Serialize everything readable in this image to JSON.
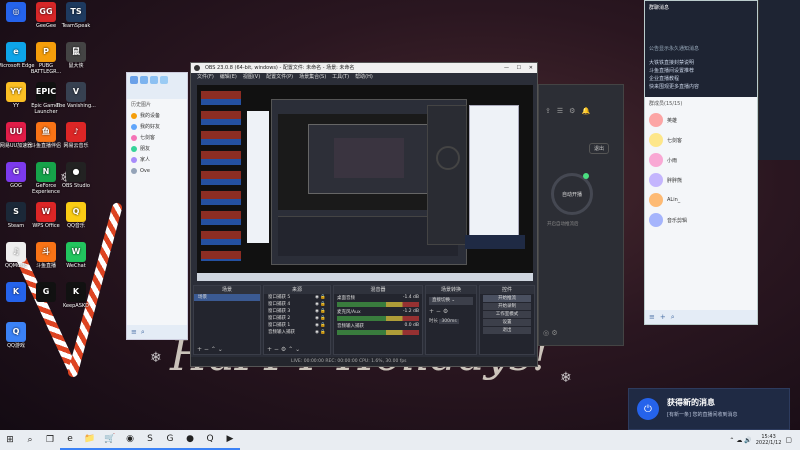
{
  "desktop_icons": [
    {
      "label": "",
      "color": "#2563eb",
      "glyph": "◎"
    },
    {
      "label": "GeeGee",
      "color": "#d62728",
      "glyph": "GG"
    },
    {
      "label": "TeamSpeak",
      "color": "#1e3a5f",
      "glyph": "TS"
    },
    {
      "label": "Microsoft Edge",
      "color": "#0ea5e9",
      "glyph": "e"
    },
    {
      "label": "PUBG BATTLEGR...",
      "color": "#f59e0b",
      "glyph": "P"
    },
    {
      "label": "鼠大侠",
      "color": "#444",
      "glyph": "鼠"
    },
    {
      "label": "YY",
      "color": "#fbbf24",
      "glyph": "YY"
    },
    {
      "label": "Epic Games Launcher",
      "color": "#111",
      "glyph": "EPIC"
    },
    {
      "label": "The Vanishing...",
      "color": "#374151",
      "glyph": "V"
    },
    {
      "label": "网易UU加速器",
      "color": "#e11d48",
      "glyph": "UU"
    },
    {
      "label": "斗鱼直播伴侣",
      "color": "#f97316",
      "glyph": "鱼"
    },
    {
      "label": "网易云音乐",
      "color": "#dc2626",
      "glyph": "♪"
    },
    {
      "label": "GOG",
      "color": "#7c3aed",
      "glyph": "G"
    },
    {
      "label": "GeForce Experience",
      "color": "#16a34a",
      "glyph": "N"
    },
    {
      "label": "OBS Studio",
      "color": "#222",
      "glyph": "●"
    },
    {
      "label": "Steam",
      "color": "#1b2838",
      "glyph": "S"
    },
    {
      "label": "WPS Office",
      "color": "#dc2626",
      "glyph": "W"
    },
    {
      "label": "QQ音乐",
      "color": "#facc15",
      "glyph": "Q"
    },
    {
      "label": "QQMusic",
      "color": "#eee",
      "glyph": "♫"
    },
    {
      "label": "斗鱼直播",
      "color": "#f97316",
      "glyph": "斗"
    },
    {
      "label": "WeChat",
      "color": "#22c55e",
      "glyph": "W"
    },
    {
      "label": "",
      "color": "#2563eb",
      "glyph": "K"
    },
    {
      "label": "",
      "color": "#111",
      "glyph": "G"
    },
    {
      "label": "KeepASKD",
      "color": "#111",
      "glyph": "K"
    },
    {
      "label": "QQ游戏",
      "color": "#3b82f6",
      "glyph": "Q"
    }
  ],
  "obs": {
    "title": "OBS 23.0.8 (64-bit, windows) - 配置文件: 未命名 - 场景: 未命名",
    "menu": [
      "文件(F)",
      "编辑(E)",
      "视图(V)",
      "配置文件(P)",
      "场景集合(S)",
      "工具(T)",
      "帮助(H)"
    ],
    "docks": {
      "scenes": "场景",
      "sources": "来源",
      "mixer": "混音器",
      "transitions": "场景转换",
      "controls": "控件"
    },
    "scene_item": "场景",
    "sources": [
      "窗口捕获 5",
      "窗口捕获 4",
      "窗口捕获 3",
      "窗口捕获 2",
      "窗口捕获 1",
      "音频输入捕获"
    ],
    "mixer_tracks": [
      {
        "name": "桌面音频",
        "level": "-1.4 dB"
      },
      {
        "name": "麦克风/Aux",
        "level": "-1.2 dB"
      },
      {
        "name": "音频输入捕获",
        "level": "0.0 dB"
      }
    ],
    "transition": "直接切换",
    "duration_label": "时长",
    "duration": "300ms",
    "controls": [
      "开始推流",
      "开始录制",
      "工作室模式",
      "设置",
      "退出"
    ],
    "status": "LIVE: 00:00:00   REC: 00:00:00   CPU: 1.6%, 30.00 fps"
  },
  "qq_left": {
    "items": [
      "我的设备",
      "我的好友",
      "七剑客",
      "朋友",
      "家人",
      "Ove"
    ],
    "header": "历史图片"
  },
  "qq_right": {
    "title": "群聊消息",
    "announcement": "公告显示永久通知消息",
    "lines": [
      "大铁铁直接封禁说明",
      "斗鱼直播间设置推荐",
      "企业直播教程",
      "快来围观更多直播内容"
    ],
    "members_header": "群成员(15/15)",
    "members": [
      "英雄",
      "七剑客",
      "小雨",
      "胖胖熊",
      "ALin_",
      "音乐剪辑"
    ]
  },
  "dark_panel": {
    "button": "退出",
    "ring_label": "自动开播",
    "hint": "开启自动推流后"
  },
  "toast": {
    "title": "获得新的消息",
    "body": "[有新一条] 您的直播间收到消息"
  },
  "taskbar": {
    "time": "15:43",
    "date": "2022/1/12",
    "items": [
      "⊞",
      "⌕",
      "❐",
      "e",
      "📁",
      "🛒",
      "◉",
      "S",
      "G",
      "●",
      "Q",
      "▶"
    ]
  }
}
